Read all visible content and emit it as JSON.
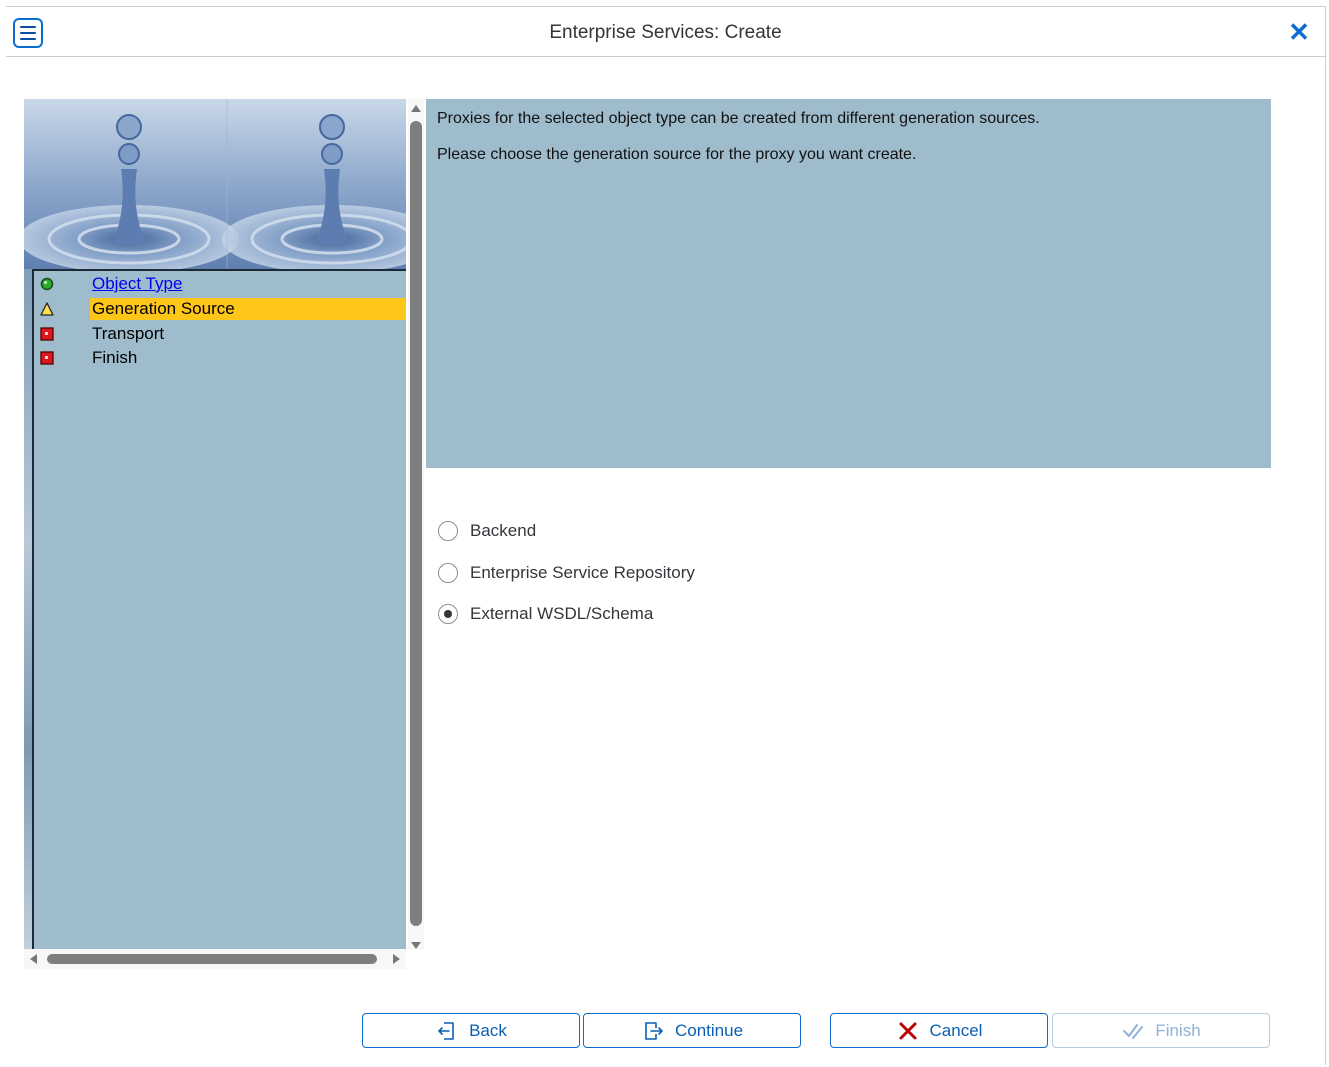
{
  "window": {
    "title": "Enterprise Services: Create",
    "close_glyph": "✕"
  },
  "navigation": {
    "steps": [
      {
        "label": "Object Type",
        "status": "completed",
        "icon": "green-circle-icon",
        "link": true
      },
      {
        "label": "Generation Source",
        "status": "current",
        "icon": "warning-triangle-icon",
        "link": false
      },
      {
        "label": "Transport",
        "status": "pending",
        "icon": "red-square-icon",
        "link": false
      },
      {
        "label": "Finish",
        "status": "pending",
        "icon": "red-square-icon",
        "link": false
      }
    ]
  },
  "info": {
    "line1": "Proxies for the selected object type can be created from different generation sources.",
    "line2": "Please choose the generation source for the proxy you want create."
  },
  "options": {
    "selected": "External WSDL/Schema",
    "items": [
      "Backend",
      "Enterprise Service Repository",
      "External WSDL/Schema"
    ]
  },
  "buttons": {
    "back": "Back",
    "continue": "Continue",
    "cancel": "Cancel",
    "finish": "Finish"
  },
  "colors": {
    "accent": "#0a6ed1",
    "panel": "#9fbccd",
    "current_step": "#ffc61a",
    "cancel_icon": "#bb0000"
  }
}
